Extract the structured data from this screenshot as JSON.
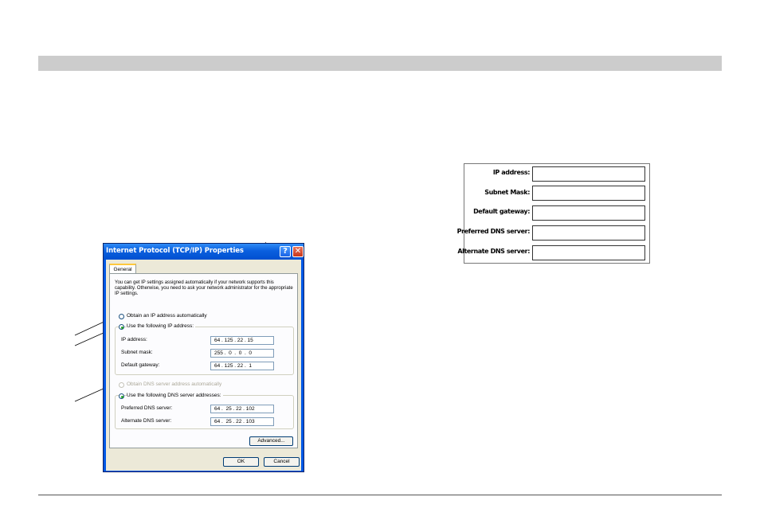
{
  "dialog": {
    "title": "Internet Protocol (TCP/IP) Properties",
    "help_glyph": "?",
    "close_glyph": "✕",
    "tab_label": "General",
    "intro_text": "You can get IP settings assigned automatically if your network supports this capability. Otherwise, you need to ask your network administrator for the appropriate IP settings.",
    "ip_auto_label": "Obtain an IP address automatically",
    "ip_manual_label": "Use the following IP address:",
    "ip_fields": [
      {
        "label": "IP address:",
        "value": "64 . 125 . 22 . 15"
      },
      {
        "label": "Subnet mask:",
        "value": "255 .  0  .  0  .  0"
      },
      {
        "label": "Default gateway:",
        "value": "64 . 125 . 22 .  1"
      }
    ],
    "dns_auto_label": "Obtain DNS server address automatically",
    "dns_manual_label": "Use the following DNS server addresses:",
    "dns_fields": [
      {
        "label": "Preferred DNS server:",
        "value": "64 .  25 . 22 . 102"
      },
      {
        "label": "Alternate DNS server:",
        "value": "64 .  25 . 22 . 103"
      }
    ],
    "advanced_label": "Advanced...",
    "ok_label": "OK",
    "cancel_label": "Cancel"
  },
  "form": {
    "rows": [
      {
        "label": "IP address:"
      },
      {
        "label": "Subnet Mask:"
      },
      {
        "label": "Default gateway:"
      },
      {
        "label": "Preferred DNS server:"
      },
      {
        "label": "Alternate DNS server:"
      }
    ]
  }
}
